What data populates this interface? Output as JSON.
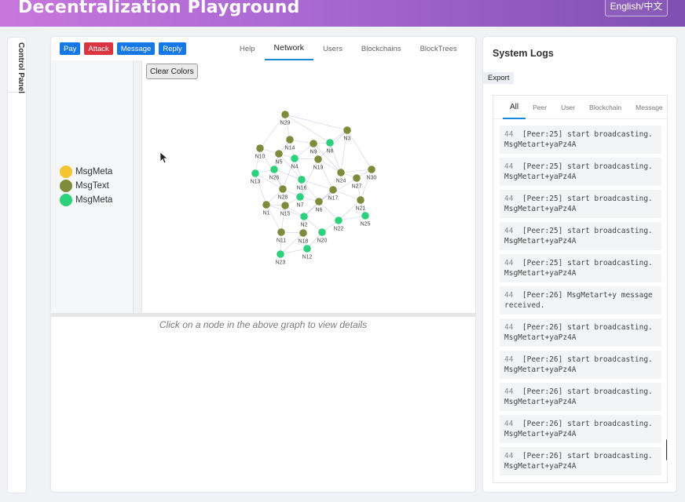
{
  "header": {
    "title": "Decentralization Playground",
    "language_button": "English/中文"
  },
  "control_panel": {
    "label": "Control Panel"
  },
  "toolbar": {
    "actions": [
      {
        "label": "Pay",
        "variant": "blue"
      },
      {
        "label": "Attack",
        "variant": "red"
      },
      {
        "label": "Message",
        "variant": "blue"
      },
      {
        "label": "Reply",
        "variant": "blue"
      }
    ],
    "tabs": [
      {
        "label": "Help",
        "active": false
      },
      {
        "label": "Network",
        "active": true
      },
      {
        "label": "Users",
        "active": false
      },
      {
        "label": "Blockchains",
        "active": false
      },
      {
        "label": "BlockTrees",
        "active": false
      }
    ]
  },
  "graph": {
    "clear_button": "Clear Colors",
    "legend": [
      {
        "label": "MsgMeta",
        "color": "#f5c431"
      },
      {
        "label": "MsgText",
        "color": "#7f8a3a"
      },
      {
        "label": "MsgMeta",
        "color": "#2bd27b"
      }
    ],
    "colors": {
      "olive": "#7f8a3a",
      "green": "#2bd27b",
      "edge": "#8c93d8"
    },
    "nodes": [
      {
        "id": "N29",
        "c": "olive"
      },
      {
        "id": "N3",
        "c": "olive"
      },
      {
        "id": "N14",
        "c": "olive"
      },
      {
        "id": "N9",
        "c": "olive"
      },
      {
        "id": "N8",
        "c": "green"
      },
      {
        "id": "N10",
        "c": "olive"
      },
      {
        "id": "N5",
        "c": "olive"
      },
      {
        "id": "N4",
        "c": "green"
      },
      {
        "id": "N19",
        "c": "olive"
      },
      {
        "id": "N13",
        "c": "green"
      },
      {
        "id": "N26",
        "c": "green"
      },
      {
        "id": "N24",
        "c": "olive"
      },
      {
        "id": "N30",
        "c": "olive"
      },
      {
        "id": "N27",
        "c": "olive"
      },
      {
        "id": "N16",
        "c": "green"
      },
      {
        "id": "N28",
        "c": "olive"
      },
      {
        "id": "N17",
        "c": "olive"
      },
      {
        "id": "N7",
        "c": "green"
      },
      {
        "id": "N1",
        "c": "olive"
      },
      {
        "id": "N15",
        "c": "olive"
      },
      {
        "id": "N6",
        "c": "olive"
      },
      {
        "id": "N21",
        "c": "olive"
      },
      {
        "id": "N2",
        "c": "green"
      },
      {
        "id": "N25",
        "c": "green"
      },
      {
        "id": "N22",
        "c": "green"
      },
      {
        "id": "N11",
        "c": "olive"
      },
      {
        "id": "N18",
        "c": "olive"
      },
      {
        "id": "N20",
        "c": "green"
      },
      {
        "id": "N23",
        "c": "green"
      },
      {
        "id": "N12",
        "c": "green"
      }
    ],
    "details_hint": "Click on a node in the above graph to view details"
  },
  "logs": {
    "title": "System Logs",
    "export_button": "Export",
    "tabs": [
      {
        "label": "All",
        "active": true
      },
      {
        "label": "Peer",
        "active": false
      },
      {
        "label": "User",
        "active": false
      },
      {
        "label": "Blockchain",
        "active": false
      },
      {
        "label": "Message",
        "active": false
      }
    ],
    "entries": [
      {
        "num": "44",
        "text": "[Peer:25] start broadcasting.MsgMetart+yaPz4A"
      },
      {
        "num": "44",
        "text": "[Peer:25] start broadcasting.MsgMetart+yaPz4A"
      },
      {
        "num": "44",
        "text": "[Peer:25] start broadcasting.MsgMetart+yaPz4A"
      },
      {
        "num": "44",
        "text": "[Peer:25] start broadcasting.MsgMetart+yaPz4A"
      },
      {
        "num": "44",
        "text": "[Peer:25] start broadcasting.MsgMetart+yaPz4A"
      },
      {
        "num": "44",
        "text": "[Peer:26] MsgMetart+y message received."
      },
      {
        "num": "44",
        "text": "[Peer:26] start broadcasting.MsgMetart+yaPz4A"
      },
      {
        "num": "44",
        "text": "[Peer:26] start broadcasting.MsgMetart+yaPz4A"
      },
      {
        "num": "44",
        "text": "[Peer:26] start broadcasting.MsgMetart+yaPz4A"
      },
      {
        "num": "44",
        "text": "[Peer:26] start broadcasting.MsgMetart+yaPz4A"
      },
      {
        "num": "44",
        "text": "[Peer:26] start broadcasting.MsgMetart+yaPz4A"
      }
    ]
  }
}
